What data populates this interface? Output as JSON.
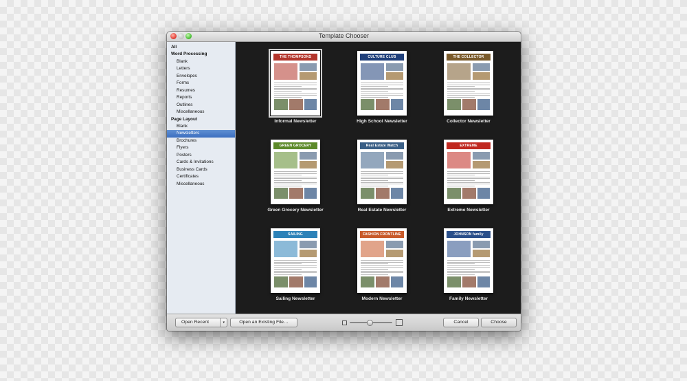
{
  "window": {
    "title": "Template Chooser"
  },
  "sidebar": {
    "items": [
      {
        "label": "All",
        "kind": "head"
      },
      {
        "label": "Word Processing",
        "kind": "head"
      },
      {
        "label": "Blank",
        "kind": "sub"
      },
      {
        "label": "Letters",
        "kind": "sub"
      },
      {
        "label": "Envelopes",
        "kind": "sub"
      },
      {
        "label": "Forms",
        "kind": "sub"
      },
      {
        "label": "Resumes",
        "kind": "sub"
      },
      {
        "label": "Reports",
        "kind": "sub"
      },
      {
        "label": "Outlines",
        "kind": "sub"
      },
      {
        "label": "Miscellaneous",
        "kind": "sub"
      },
      {
        "label": "Page Layout",
        "kind": "head"
      },
      {
        "label": "Blank",
        "kind": "sub"
      },
      {
        "label": "Newsletters",
        "kind": "sub",
        "selected": true
      },
      {
        "label": "Brochures",
        "kind": "sub"
      },
      {
        "label": "Flyers",
        "kind": "sub"
      },
      {
        "label": "Posters",
        "kind": "sub"
      },
      {
        "label": "Cards & Invitations",
        "kind": "sub"
      },
      {
        "label": "Business Cards",
        "kind": "sub"
      },
      {
        "label": "Certificates",
        "kind": "sub"
      },
      {
        "label": "Miscellaneous",
        "kind": "sub"
      }
    ]
  },
  "templates": [
    {
      "label": "Informal Newsletter",
      "masthead": "THE THOMPSONS",
      "accent": "#b3362c",
      "selected": true
    },
    {
      "label": "High School Newsletter",
      "masthead": "CULTURE CLUB",
      "accent": "#1f3f7a"
    },
    {
      "label": "Collector Newsletter",
      "masthead": "THE COLLECTOR",
      "accent": "#7a5a2a"
    },
    {
      "label": "Green Grocery Newsletter",
      "masthead": "GREEN GROCERY",
      "accent": "#5d8a2a"
    },
    {
      "label": "Real Estate Newsletter",
      "masthead": "Real Estate Watch",
      "accent": "#3a5f86"
    },
    {
      "label": "Extreme Newsletter",
      "masthead": "EXTREME",
      "accent": "#c0281f"
    },
    {
      "label": "Sailing Newsletter",
      "masthead": "SAILING",
      "accent": "#2d82b8"
    },
    {
      "label": "Modern Newsletter",
      "masthead": "FASHION FRONTLINE",
      "accent": "#c85a2a"
    },
    {
      "label": "Family Newsletter",
      "masthead": "JOHNSON family",
      "accent": "#2a4f8a"
    }
  ],
  "bottombar": {
    "open_recent": "Open Recent",
    "open_existing": "Open an Existing File…",
    "cancel": "Cancel",
    "choose": "Choose"
  },
  "icons": {
    "zoom_small": "small-thumbnail-icon",
    "zoom_large": "large-thumbnail-icon",
    "dropdown": "chevron-down-icon"
  }
}
